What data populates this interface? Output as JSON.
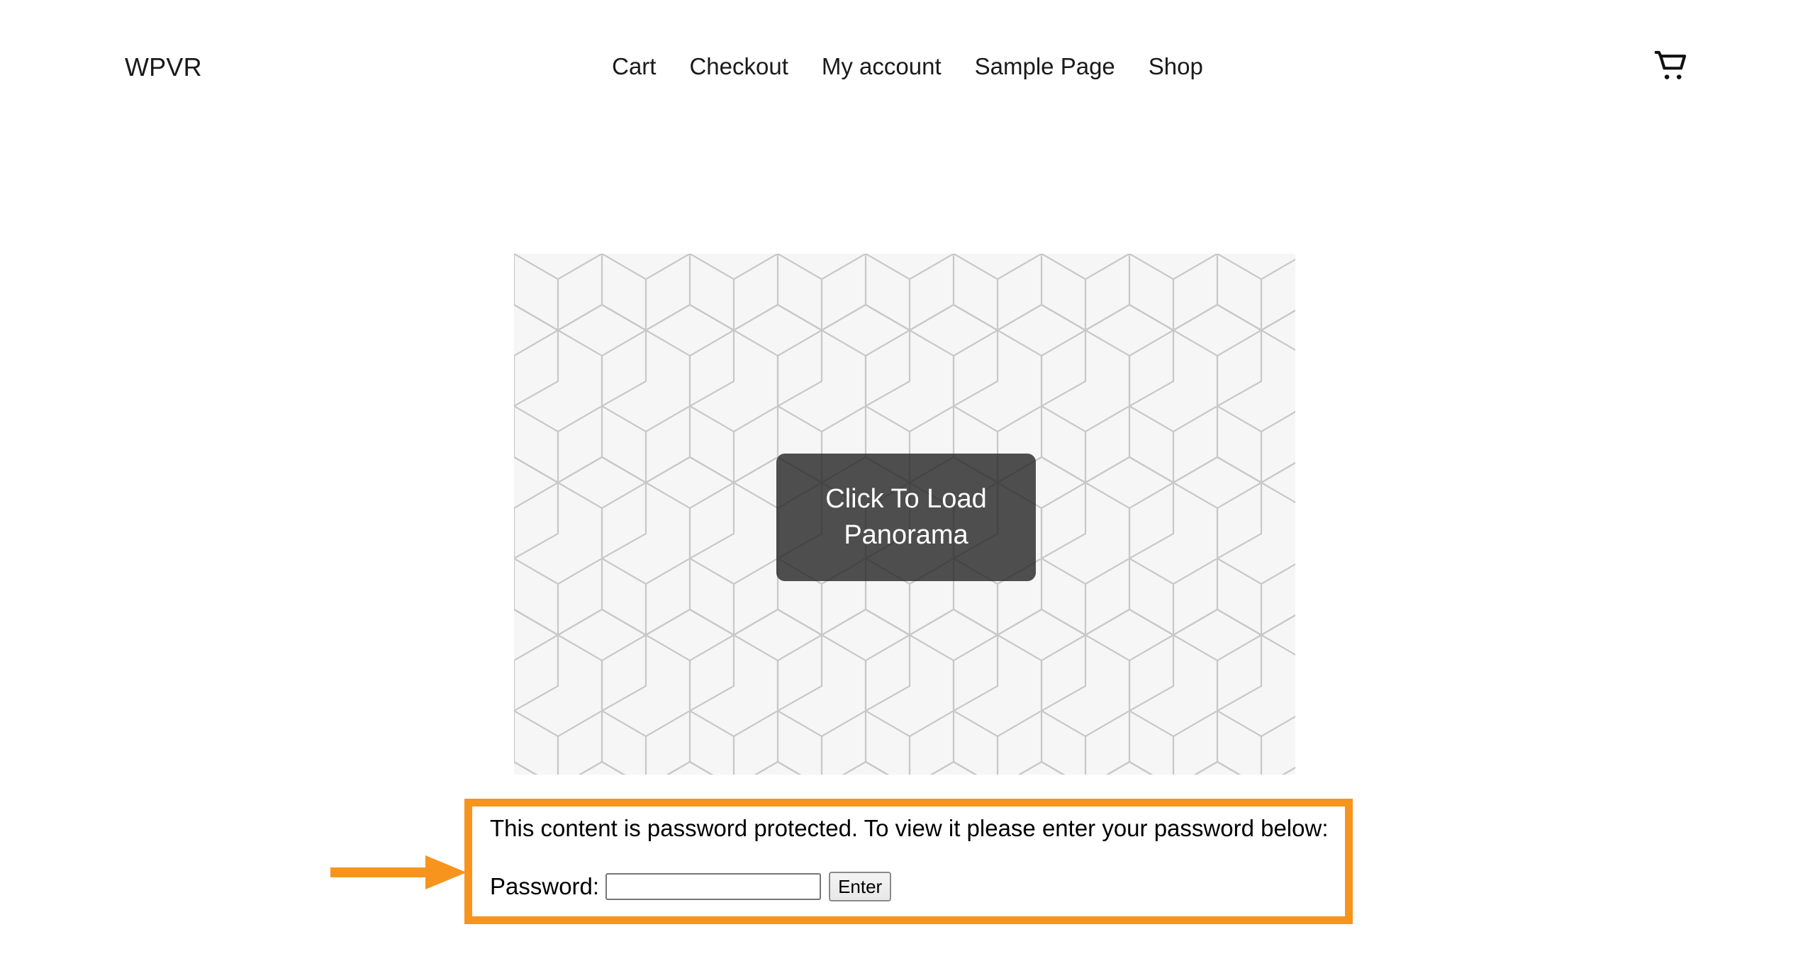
{
  "header": {
    "brand": "WPVR",
    "nav_items": [
      {
        "label": "Cart",
        "name": "nav-cart"
      },
      {
        "label": "Checkout",
        "name": "nav-checkout"
      },
      {
        "label": "My account",
        "name": "nav-my-account"
      },
      {
        "label": "Sample Page",
        "name": "nav-sample-page"
      },
      {
        "label": "Shop",
        "name": "nav-shop"
      }
    ],
    "cart_icon": "shopping-cart-icon"
  },
  "panorama": {
    "load_button_label": "Click To Load Panorama",
    "placeholder_pattern": "isometric-cube-pattern",
    "overlay_color": "#282828",
    "overlay_text_color": "#ffffff"
  },
  "password_protection": {
    "message": "This content is password protected. To view it please enter your password below:",
    "label": "Password:",
    "input_value": "",
    "input_placeholder": "",
    "submit_label": "Enter",
    "highlight_color": "#F7941E"
  },
  "annotation": {
    "arrow_color": "#F7941E",
    "arrow_direction": "right",
    "points_to": "password-protection-box"
  }
}
